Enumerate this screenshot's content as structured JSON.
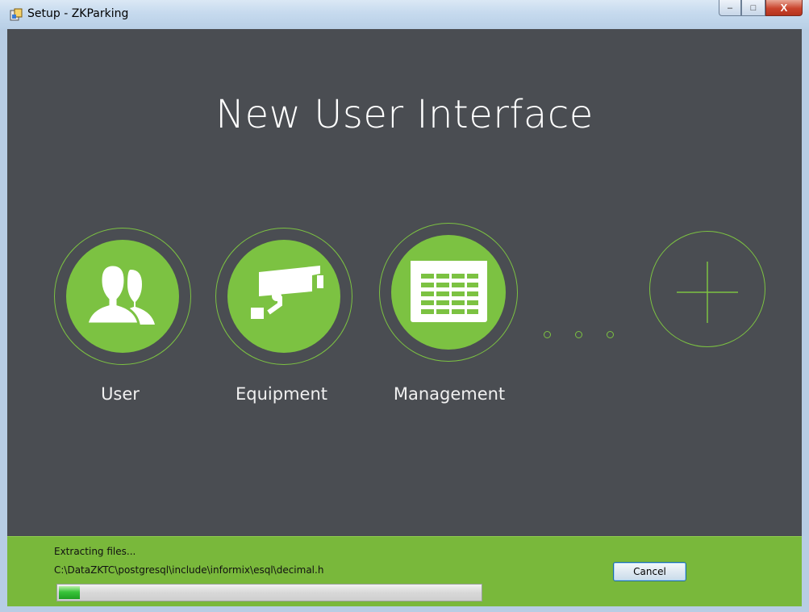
{
  "window": {
    "title": "Setup - ZKParking",
    "app_icon": "installer-icon",
    "controls": {
      "minimize": "–",
      "maximize": "□",
      "close": "X"
    }
  },
  "main": {
    "heading": "New User Interface",
    "features": [
      {
        "label": "User",
        "icon": "users-icon"
      },
      {
        "label": "Equipment",
        "icon": "camera-icon"
      },
      {
        "label": "Management",
        "icon": "calendar-icon"
      }
    ],
    "more_icon": "ellipsis-icon",
    "add_icon": "plus-icon"
  },
  "footer": {
    "status_text": "Extracting files...",
    "current_file": "C:\\DataZKTC\\postgresql\\include\\informix\\esql\\decimal.h",
    "progress": 0.05,
    "cancel_label": "Cancel"
  },
  "colors": {
    "accent": "#7cc242",
    "background": "#4a4d52",
    "footer": "#79b83b"
  }
}
